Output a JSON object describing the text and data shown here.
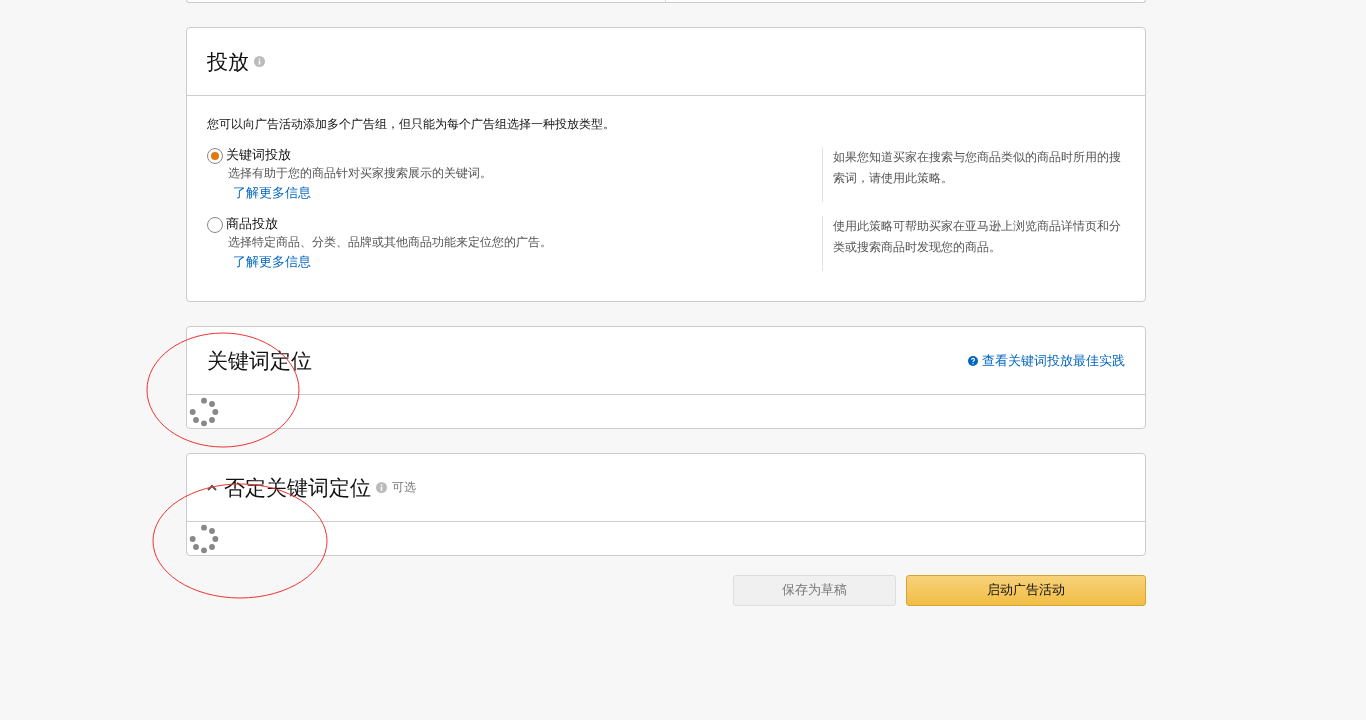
{
  "targeting": {
    "title": "投放",
    "intro": "您可以向广告活动添加多个广告组，但只能为每个广告组选择一种投放类型。",
    "options": [
      {
        "label": "关键词投放",
        "description": "选择有助于您的商品针对买家搜索展示的关键词。",
        "link": "了解更多信息",
        "hint": "如果您知道买家在搜索与您商品类似的商品时所用的搜索词，请使用此策略。",
        "selected": true
      },
      {
        "label": "商品投放",
        "description": "选择特定商品、分类、品牌或其他商品功能来定位您的广告。",
        "link": "了解更多信息",
        "hint": "使用此策略可帮助买家在亚马逊上浏览商品详情页和分类或搜索商品时发现您的商品。",
        "selected": false
      }
    ]
  },
  "keyword_targeting": {
    "title": "关键词定位",
    "help_link": "查看关键词投放最佳实践"
  },
  "negative_targeting": {
    "title": "否定关键词定位",
    "tag": "可选",
    "expanded": true
  },
  "buttons": [
    {
      "label": "保存为草稿",
      "kind": "secondary"
    },
    {
      "label": "启动广告活动",
      "kind": "primary"
    }
  ]
}
